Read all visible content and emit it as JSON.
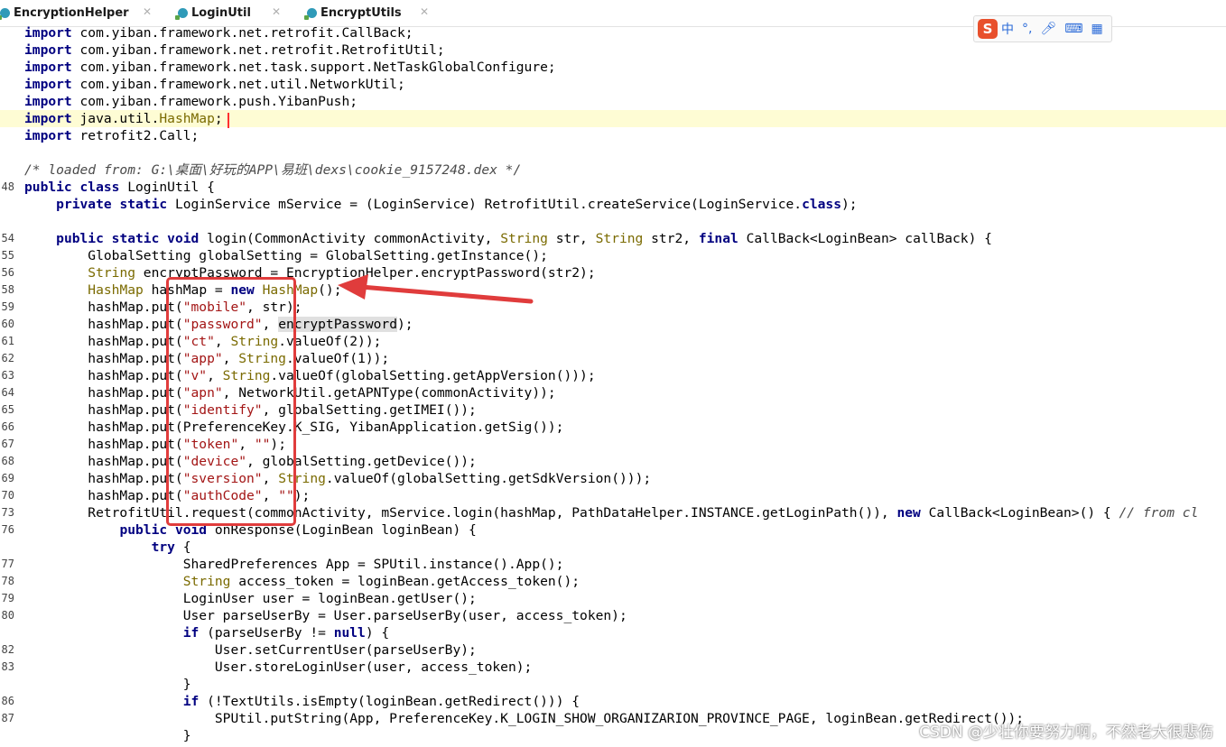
{
  "tabs": [
    {
      "label": "EncryptionHelper"
    },
    {
      "label": "LoginUtil"
    },
    {
      "label": "EncryptUtils"
    }
  ],
  "ime_bar": {
    "logo": "S",
    "lang": "中",
    "punct": "°,",
    "mic_icon": "microphone-icon",
    "kbd_icon": "keyboard-icon",
    "grid_icon": "grid-icon"
  },
  "watermark": "CSDN @少壮你要努力啊，不然老大很悲伤",
  "colors": {
    "keyword": "#000080",
    "string": "#008000",
    "highlight_line": "#fefcd4",
    "annotation_red": "#e03c3c"
  },
  "code_lines": [
    {
      "num": "",
      "html": "<span class='kw'>import</span> com.yiban.framework.net.retrofit.CallBack;"
    },
    {
      "num": "",
      "html": "<span class='kw'>import</span> com.yiban.framework.net.retrofit.RetrofitUtil;"
    },
    {
      "num": "",
      "html": "<span class='kw'>import</span> com.yiban.framework.net.task.support.NetTaskGlobalConfigure;"
    },
    {
      "num": "",
      "html": "<span class='kw'>import</span> com.yiban.framework.net.util.NetworkUtil;"
    },
    {
      "num": "",
      "html": "<span class='kw'>import</span> com.yiban.framework.push.YibanPush;"
    },
    {
      "num": "",
      "hl": true,
      "html": "<span class='kw'>import</span> java.util.<span style='color:#7a6a00'>HashMap</span>;"
    },
    {
      "num": "",
      "html": "<span class='kw'>import</span> retrofit2.Call;"
    },
    {
      "num": "",
      "html": ""
    },
    {
      "num": "",
      "html": "<span class='cm'>/* loaded from: G:\\桌面\\好玩的APP\\易班\\dexs\\cookie_9157248.dex */</span>"
    },
    {
      "num": "48",
      "html": "<span class='kw'>public class</span> LoginUtil {"
    },
    {
      "num": "",
      "html": "    <span class='kw'>private static</span> LoginService mService = (LoginService) RetrofitUtil.createService(LoginService.<span class='kw'>class</span>);"
    },
    {
      "num": "",
      "html": ""
    },
    {
      "num": "54",
      "html": "    <span class='kw'>public static void</span> login(CommonActivity commonActivity, <span style='color:#7a6a00'>String</span> str, <span style='color:#7a6a00'>String</span> str2, <span class='kw'>final</span> CallBack&lt;LoginBean&gt; callBack) {"
    },
    {
      "num": "55",
      "html": "        GlobalSetting globalSetting = GlobalSetting.getInstance();"
    },
    {
      "num": "56",
      "html": "        <span style='color:#7a6a00'>String</span> encryptPassword = EncryptionHelper.encryptPassword(str2);"
    },
    {
      "num": "58",
      "html": "        <span style='color:#7a6a00'>HashMap</span> hashMap = <span class='kw'>new</span> <span style='color:#7a6a00'>HashMap</span>();"
    },
    {
      "num": "59",
      "html": "        hashMap.put(<span class='sg'>\"mobile\"</span>, str);"
    },
    {
      "num": "60",
      "html": "        hashMap.put(<span class='sg'>\"password\"</span>, <span class='hlt'>encryptPassword</span>);"
    },
    {
      "num": "61",
      "html": "        hashMap.put(<span class='sg'>\"ct\"</span>, <span style='color:#7a6a00'>String</span>.valueOf(2));"
    },
    {
      "num": "62",
      "html": "        hashMap.put(<span class='sg'>\"app\"</span>, <span style='color:#7a6a00'>String</span>.valueOf(1));"
    },
    {
      "num": "63",
      "html": "        hashMap.put(<span class='sg'>\"v\"</span>, <span style='color:#7a6a00'>String</span>.valueOf(globalSetting.getAppVersion()));"
    },
    {
      "num": "64",
      "html": "        hashMap.put(<span class='sg'>\"apn\"</span>, NetworkUtil.getAPNType(commonActivity));"
    },
    {
      "num": "65",
      "html": "        hashMap.put(<span class='sg'>\"identify\"</span>, globalSetting.getIMEI());"
    },
    {
      "num": "66",
      "html": "        hashMap.put(PreferenceKey.K_SIG, YibanApplication.getSig());"
    },
    {
      "num": "67",
      "html": "        hashMap.put(<span class='sg'>\"token\"</span>, <span class='sg'>\"\"</span>);"
    },
    {
      "num": "68",
      "html": "        hashMap.put(<span class='sg'>\"device\"</span>, globalSetting.getDevice());"
    },
    {
      "num": "69",
      "html": "        hashMap.put(<span class='sg'>\"sversion\"</span>, <span style='color:#7a6a00'>String</span>.valueOf(globalSetting.getSdkVersion()));"
    },
    {
      "num": "70",
      "html": "        hashMap.put(<span class='sg'>\"authCode\"</span>, <span class='sg'>\"\"</span>);"
    },
    {
      "num": "73",
      "html": "        RetrofitUtil.request(commonActivity, mService.login(hashMap, PathDataHelper.INSTANCE.getLoginPath()), <span class='kw'>new</span> CallBack&lt;LoginBean&gt;() { <span class='cm'>// from cl</span>"
    },
    {
      "num": "76",
      "html": "            <span class='kw'>public void</span> onResponse(LoginBean loginBean) {"
    },
    {
      "num": "",
      "html": "                <span class='kw'>try</span> {"
    },
    {
      "num": "77",
      "html": "                    SharedPreferences App = SPUtil.instance().App();"
    },
    {
      "num": "78",
      "html": "                    <span style='color:#7a6a00'>String</span> access_token = loginBean.getAccess_token();"
    },
    {
      "num": "79",
      "html": "                    LoginUser user = loginBean.getUser();"
    },
    {
      "num": "80",
      "html": "                    User parseUserBy = User.parseUserBy(user, access_token);"
    },
    {
      "num": "",
      "html": "                    <span class='kw'>if</span> (parseUserBy != <span class='kw'>null</span>) {"
    },
    {
      "num": "82",
      "html": "                        User.setCurrentUser(parseUserBy);"
    },
    {
      "num": "83",
      "html": "                        User.storeLoginUser(user, access_token);"
    },
    {
      "num": "",
      "html": "                    }"
    },
    {
      "num": "86",
      "html": "                    <span class='kw'>if</span> (!TextUtils.isEmpty(loginBean.getRedirect())) {"
    },
    {
      "num": "87",
      "html": "                        SPUtil.putString(App, PreferenceKey.K_LOGIN_SHOW_ORGANIZARION_PROVINCE_PAGE, loginBean.getRedirect());"
    },
    {
      "num": "",
      "html": "                    }"
    }
  ]
}
